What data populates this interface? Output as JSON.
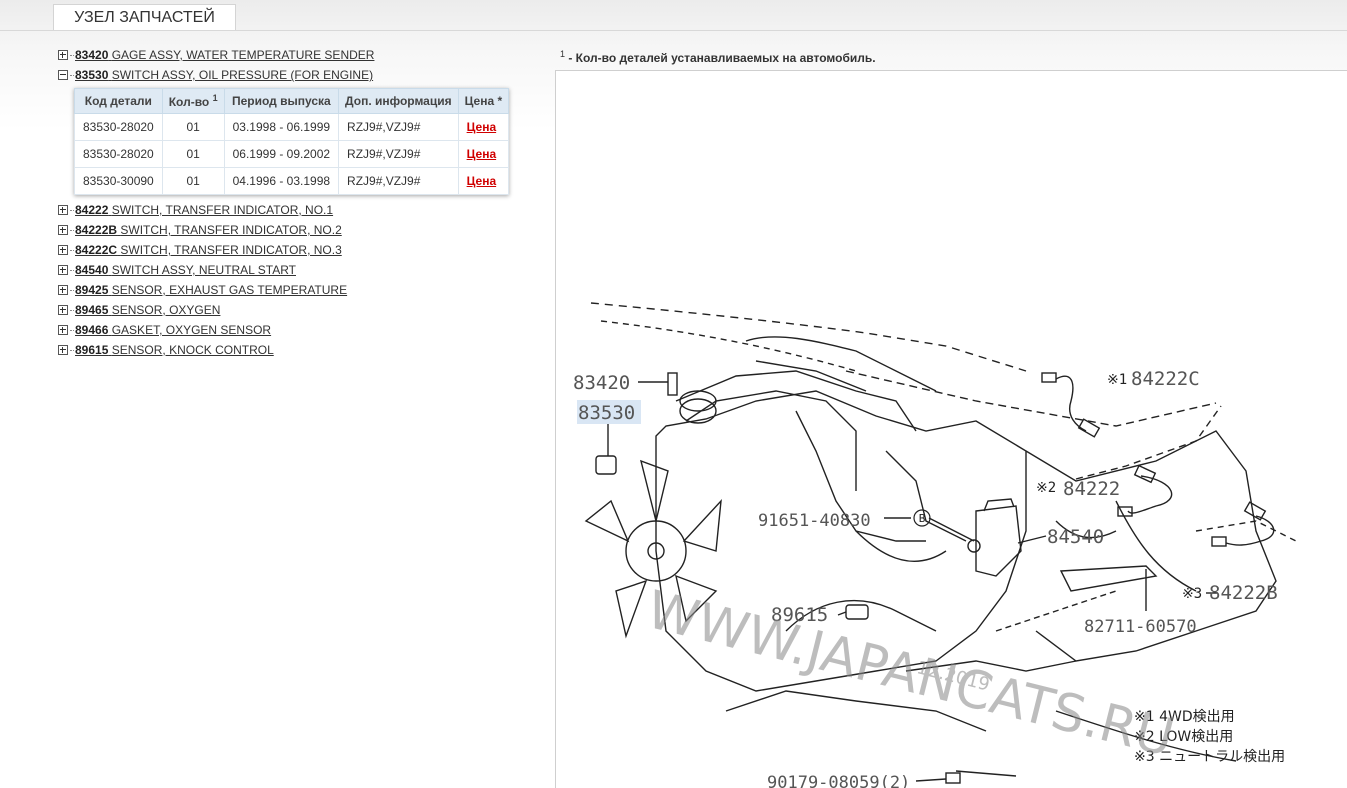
{
  "tab": {
    "label": "УЗЕЛ ЗАПЧАСТЕЙ"
  },
  "tree": {
    "before": [
      {
        "code": "83420",
        "name": "GAGE ASSY, WATER TEMPERATURE SENDER"
      },
      {
        "code": "83530",
        "name": "SWITCH ASSY, OIL PRESSURE (FOR ENGINE)"
      }
    ],
    "after": [
      {
        "code": "84222",
        "name": "SWITCH, TRANSFER INDICATOR, NO.1"
      },
      {
        "code": "84222B",
        "name": "SWITCH, TRANSFER INDICATOR, NO.2"
      },
      {
        "code": "84222C",
        "name": "SWITCH, TRANSFER INDICATOR, NO.3"
      },
      {
        "code": "84540",
        "name": "SWITCH ASSY, NEUTRAL START"
      },
      {
        "code": "89425",
        "name": "SENSOR, EXHAUST GAS TEMPERATURE"
      },
      {
        "code": "89465",
        "name": "SENSOR, OXYGEN"
      },
      {
        "code": "89466",
        "name": "GASKET, OXYGEN SENSOR"
      },
      {
        "code": "89615",
        "name": "SENSOR, KNOCK CONTROL"
      }
    ]
  },
  "table": {
    "headers": {
      "code": "Код детали",
      "qty": "Кол-во",
      "qty_sup": "1",
      "period": "Период выпуска",
      "info": "Доп. информация",
      "price": "Цена *"
    },
    "rows": [
      {
        "code": "83530-28020",
        "qty": "01",
        "period": "03.1998 - 06.1999",
        "info": "RZJ9#,VZJ9#",
        "price": "Цена"
      },
      {
        "code": "83530-28020",
        "qty": "01",
        "period": "06.1999 - 09.2002",
        "info": "RZJ9#,VZJ9#",
        "price": "Цена"
      },
      {
        "code": "83530-30090",
        "qty": "01",
        "period": "04.1996 - 03.1998",
        "info": "RZJ9#,VZJ9#",
        "price": "Цена"
      }
    ]
  },
  "note": {
    "sup": "1",
    "text": " - Кол-во деталей устанавливаемых на автомобиль."
  },
  "diagram": {
    "labels": {
      "p83420": "83420",
      "p83530": "83530",
      "p84222c": "84222C",
      "p84222": "84222",
      "p91651": "91651-40830",
      "p84540": "84540",
      "p89615": "89615",
      "p82711": "82711-60570",
      "p84222b": "84222B",
      "p90179": "90179-08059(2)",
      "mark1": "※1",
      "mark2": "※2",
      "mark3": "※3",
      "circle_b": "B"
    },
    "legend": [
      "※1 4WD検出用",
      "※2 LOW検出用",
      "※3 ニュートラル検出用"
    ],
    "watermark": "WWW.JAPANCATS.RU",
    "watermark_date": "12.2019"
  }
}
